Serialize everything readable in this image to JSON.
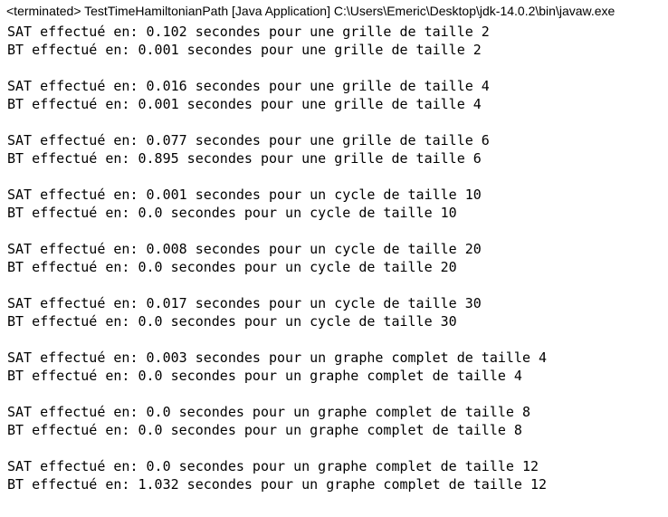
{
  "console": {
    "header": "<terminated> TestTimeHamiltonianPath [Java Application] C:\\Users\\Emeric\\Desktop\\jdk-14.0.2\\bin\\javaw.exe",
    "groups": [
      {
        "lines": [
          "SAT effectué en: 0.102 secondes pour une grille de taille 2",
          "BT effectué en: 0.001 secondes pour une grille de taille 2"
        ]
      },
      {
        "lines": [
          "SAT effectué en: 0.016 secondes pour une grille de taille 4",
          "BT effectué en: 0.001 secondes pour une grille de taille 4"
        ]
      },
      {
        "lines": [
          "SAT effectué en: 0.077 secondes pour une grille de taille 6",
          "BT effectué en: 0.895 secondes pour une grille de taille 6"
        ]
      },
      {
        "lines": [
          "SAT effectué en: 0.001 secondes pour un cycle de taille 10",
          "BT effectué en: 0.0 secondes pour un cycle de taille 10"
        ]
      },
      {
        "lines": [
          "SAT effectué en: 0.008 secondes pour un cycle de taille 20",
          "BT effectué en: 0.0 secondes pour un cycle de taille 20"
        ]
      },
      {
        "lines": [
          "SAT effectué en: 0.017 secondes pour un cycle de taille 30",
          "BT effectué en: 0.0 secondes pour un cycle de taille 30"
        ]
      },
      {
        "lines": [
          "SAT effectué en: 0.003 secondes pour un graphe complet de taille 4",
          "BT effectué en: 0.0 secondes pour un graphe complet de taille 4"
        ]
      },
      {
        "lines": [
          "SAT effectué en: 0.0 secondes pour un graphe complet de taille 8",
          "BT effectué en: 0.0 secondes pour un graphe complet de taille 8"
        ]
      },
      {
        "lines": [
          "SAT effectué en: 0.0 secondes pour un graphe complet de taille 12",
          "BT effectué en: 1.032 secondes pour un graphe complet de taille 12"
        ]
      }
    ]
  }
}
